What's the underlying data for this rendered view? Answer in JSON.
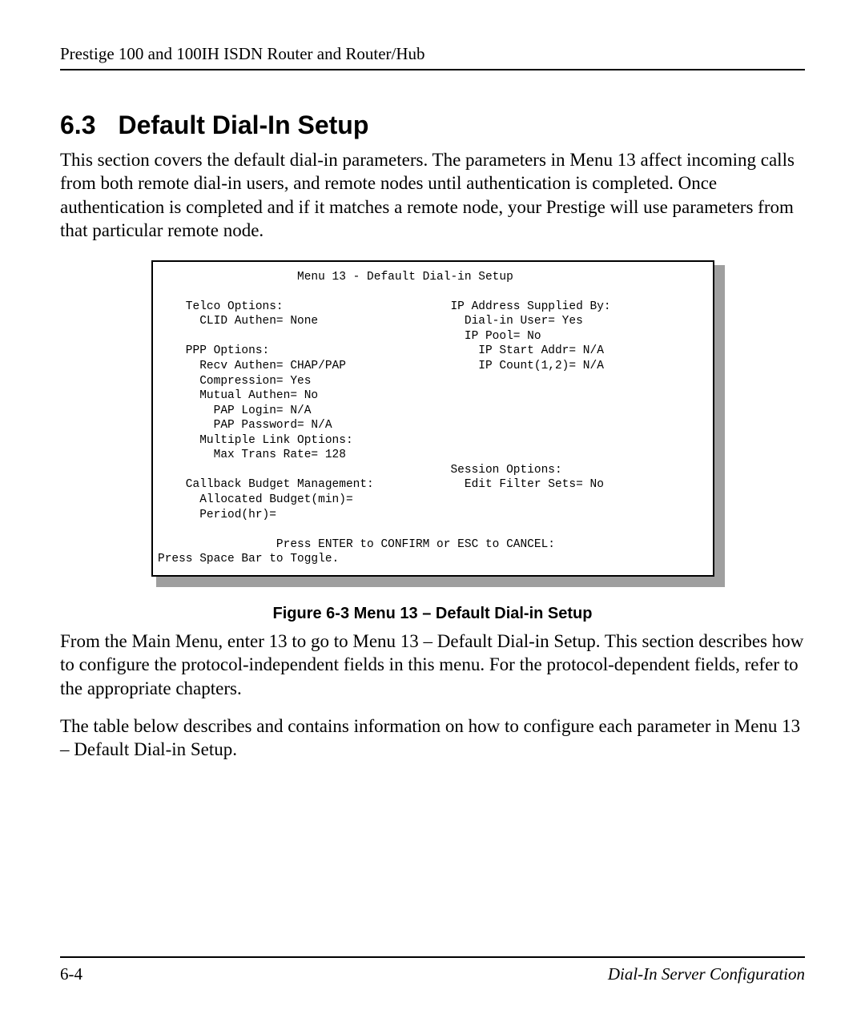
{
  "header": {
    "running_head": "Prestige 100 and 100IH ISDN Router and Router/Hub"
  },
  "section": {
    "number": "6.3",
    "title": "Default Dial-In Setup"
  },
  "paragraphs": {
    "intro": "This section covers the default dial-in parameters. The parameters in Menu 13 affect incoming calls from both remote dial-in users, and remote nodes until authentication is completed. Once authentication is completed and if it matches a remote node, your Prestige will use parameters from that particular remote node.",
    "after_fig_1": "From the Main Menu, enter 13 to go to Menu 13 – Default Dial-in Setup. This section describes how to configure the protocol-independent fields in this menu. For the protocol-dependent fields, refer to the appropriate chapters.",
    "after_fig_2": "The table below describes and contains information on how to configure each parameter in Menu 13 – Default Dial-in Setup."
  },
  "figure": {
    "caption": "Figure 6-3 Menu 13 – Default Dial-in Setup",
    "terminal_text": "                    Menu 13 - Default Dial-in Setup\n\n    Telco Options:                        IP Address Supplied By:\n      CLID Authen= None                     Dial-in User= Yes\n                                            IP Pool= No\n    PPP Options:                              IP Start Addr= N/A\n      Recv Authen= CHAP/PAP                   IP Count(1,2)= N/A\n      Compression= Yes\n      Mutual Authen= No\n        PAP Login= N/A\n        PAP Password= N/A\n      Multiple Link Options:\n        Max Trans Rate= 128\n                                          Session Options:\n    Callback Budget Management:             Edit Filter Sets= No\n      Allocated Budget(min)=\n      Period(hr)=\n\n                 Press ENTER to CONFIRM or ESC to CANCEL:\nPress Space Bar to Toggle."
  },
  "footer": {
    "page_number": "6-4",
    "chapter_title": "Dial-In Server Configuration"
  }
}
